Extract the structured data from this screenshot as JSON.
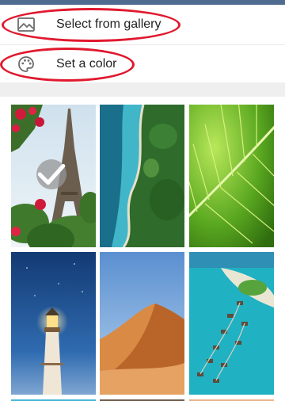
{
  "menu": {
    "gallery": {
      "label": "Select from gallery",
      "icon": "image-icon"
    },
    "color": {
      "label": "Set a color",
      "icon": "palette-icon"
    }
  },
  "annotations": {
    "highlight_color": "#e0192e"
  },
  "wallpapers": [
    {
      "name": "eiffel-tower",
      "selected": true
    },
    {
      "name": "coast-aerial",
      "selected": false
    },
    {
      "name": "green-leaf",
      "selected": false
    },
    {
      "name": "lighthouse",
      "selected": false
    },
    {
      "name": "desert-dune",
      "selected": false
    },
    {
      "name": "island-resort",
      "selected": false
    }
  ]
}
